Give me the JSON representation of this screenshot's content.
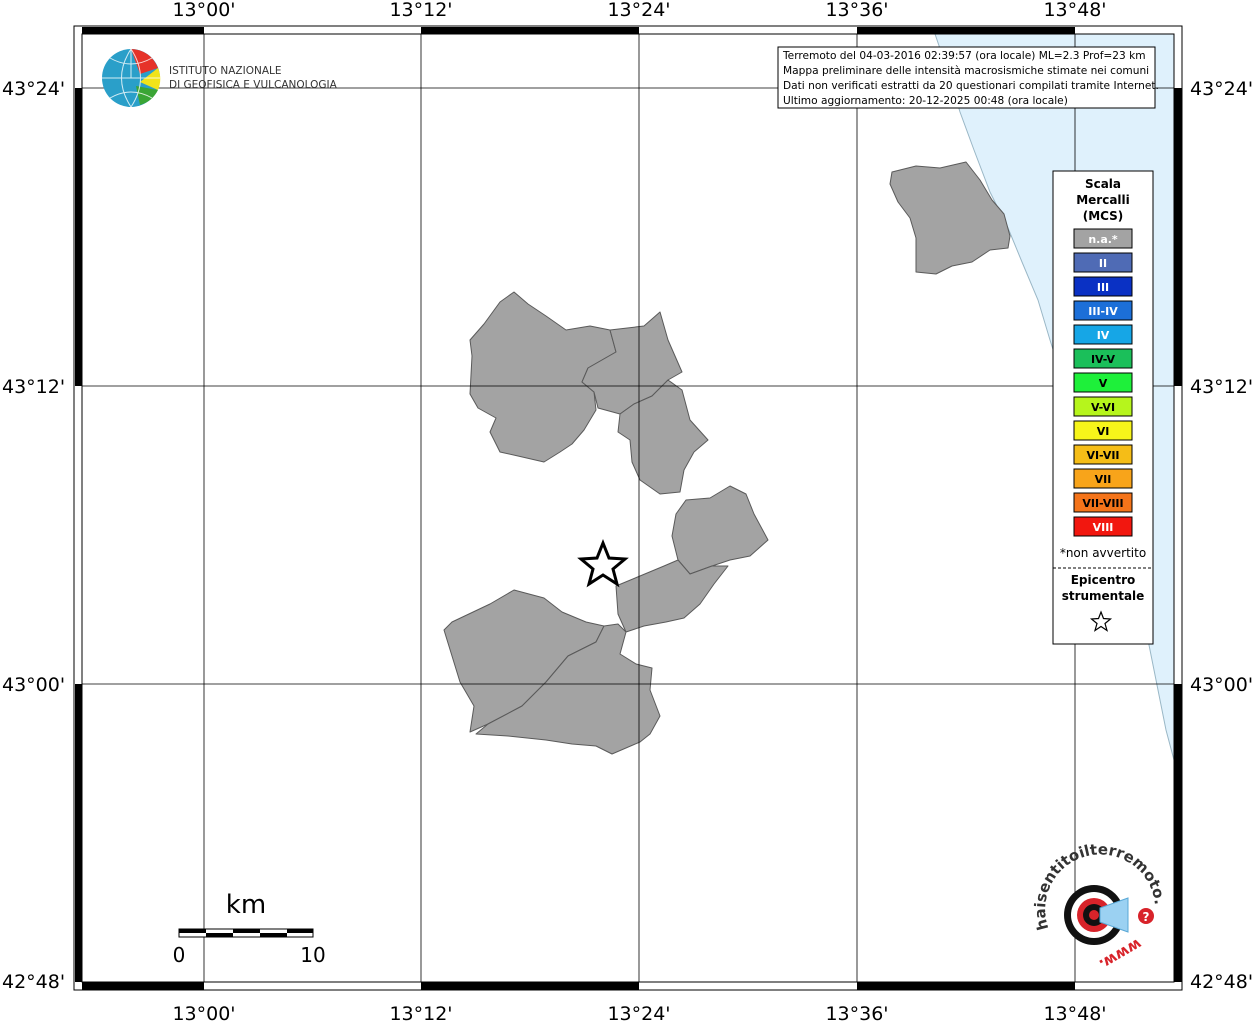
{
  "map": {
    "top_lon_labels": [
      "13°00'",
      "13°12'",
      "13°24'",
      "13°36'",
      "13°48'"
    ],
    "bottom_lon_labels": [
      "13°00'",
      "13°12'",
      "13°24'",
      "13°36'",
      "13°48'"
    ],
    "left_lat_labels": [
      "43°24'",
      "43°12'",
      "43°00'",
      "42°48'"
    ],
    "right_lat_labels": [
      "43°24'",
      "43°12'",
      "43°00'",
      "42°48'"
    ],
    "colors": {
      "land": "#ffffff",
      "sea": "#dff1fc",
      "municipality_fill": "#a3a3a3",
      "municipality_stroke": "#5a5a5a",
      "grid": "#000000"
    }
  },
  "info_box": {
    "line1": "Terremoto del 04-03-2016 02:39:57 (ora locale) ML=2.3 Prof=23 km",
    "line2": "Mappa preliminare delle intensità macrosismiche stimate nei comuni",
    "line3": "Dati non verificati estratti da 20 questionari compilati tramite Internet.",
    "line4": "Ultimo aggiornamento: 20-12-2025 00:48 (ora locale)"
  },
  "ingv_logo": {
    "line1": "ISTITUTO NAZIONALE",
    "line2": "DI GEOFISICA E VULCANOLOGIA"
  },
  "legend": {
    "title_line1": "Scala",
    "title_line2": "Mercalli",
    "title_line3": "(MCS)",
    "items": [
      {
        "label": "n.a.*",
        "color": "#a3a3a3",
        "text_color": "#ffffff"
      },
      {
        "label": "II",
        "color": "#4f6bb5",
        "text_color": "#ffffff"
      },
      {
        "label": "III",
        "color": "#0a31c4",
        "text_color": "#ffffff"
      },
      {
        "label": "III-IV",
        "color": "#1c6fd8",
        "text_color": "#ffffff"
      },
      {
        "label": "IV",
        "color": "#16a6e6",
        "text_color": "#ffffff"
      },
      {
        "label": "IV-V",
        "color": "#1bbf5a",
        "text_color": "#000000"
      },
      {
        "label": "V",
        "color": "#1ef03a",
        "text_color": "#000000"
      },
      {
        "label": "V-VI",
        "color": "#b6f51c",
        "text_color": "#000000"
      },
      {
        "label": "VI",
        "color": "#f7f51a",
        "text_color": "#000000"
      },
      {
        "label": "VI-VII",
        "color": "#f5bd17",
        "text_color": "#000000"
      },
      {
        "label": "VII",
        "color": "#f8a41a",
        "text_color": "#000000"
      },
      {
        "label": "VII-VIII",
        "color": "#f4741a",
        "text_color": "#000000"
      },
      {
        "label": "VIII",
        "color": "#f2170f",
        "text_color": "#ffffff"
      }
    ],
    "note": "*non avvertito",
    "epicenter_line1": "Epicentro",
    "epicenter_line2": "strumentale"
  },
  "scale_bar": {
    "unit": "km",
    "min_label": "0",
    "max_label": "10"
  },
  "hst_logo": {
    "text": "haisentitoilterremoto.it",
    "www": "www."
  }
}
